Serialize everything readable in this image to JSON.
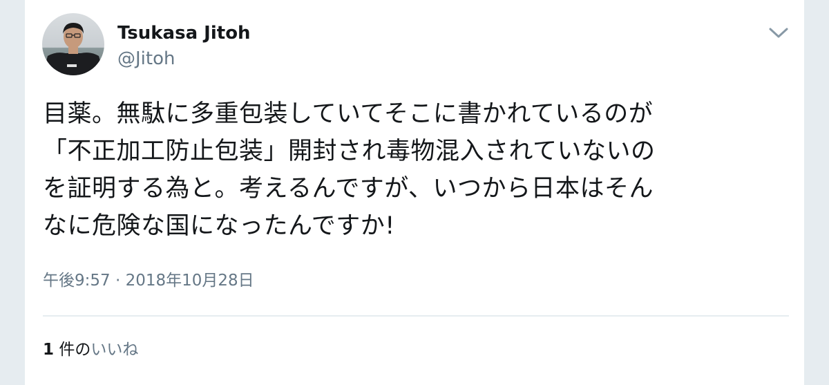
{
  "tweet": {
    "author": {
      "display_name": "Tsukasa Jitoh",
      "handle": "@Jitoh",
      "avatar_icon": "profile-photo"
    },
    "menu_icon": "chevron-down-icon",
    "text_lines": [
      "目薬。無駄に多重包装していてそこに書かれているのが",
      "「不正加工防止包装」開封され毒物混入されていないの",
      "を証明する為と。考えるんですが、いつから日本はそん",
      "なに危険な国になったんですか!"
    ],
    "time": "午後9:57",
    "separator": "·",
    "date": "2018年10月28日",
    "likes": {
      "count": "1",
      "unit": "件の",
      "label": "いいね"
    }
  },
  "colors": {
    "text_primary": "#14171a",
    "text_secondary": "#657786",
    "divider": "#e6ecf0",
    "caret": "#8899a6"
  }
}
